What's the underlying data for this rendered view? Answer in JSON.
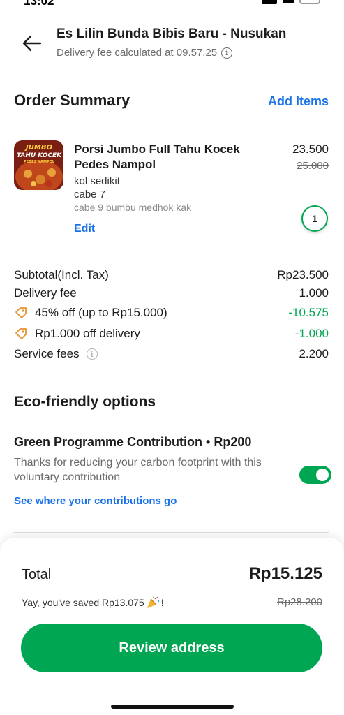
{
  "status_bar": {
    "time": "13:02"
  },
  "header": {
    "store_title": "Es Lilin Bunda Bibis Baru - Nusukan",
    "delivery_note": "Delivery fee calculated at 09.57.25"
  },
  "order_summary": {
    "title": "Order Summary",
    "add_items_label": "Add Items",
    "item": {
      "name": "Porsi Jumbo Full Tahu Kocek Pedes Nampol",
      "price": "23.500",
      "original_price": "25.000",
      "notes": [
        "kol sedikit",
        "cabe 7"
      ],
      "note_faded": "cabe 9 bumbu medhok kak",
      "edit_label": "Edit",
      "quantity": "1",
      "thumb_text_top": "JUMBO",
      "thumb_text_mid": "TAHU KOCEK",
      "thumb_text_bot": "PEDES NAMPOL"
    }
  },
  "breakdown": {
    "subtotal_label": "Subtotal(Incl. Tax)",
    "subtotal_value": "Rp23.500",
    "delivery_label": "Delivery fee",
    "delivery_value": "1.000",
    "promo1_label": "45% off (up to Rp15.000)",
    "promo1_value": "-10.575",
    "promo2_label": "Rp1.000 off delivery",
    "promo2_value": "-1.000",
    "service_label": "Service fees",
    "service_value": "2.200"
  },
  "eco": {
    "title": "Eco-friendly options",
    "programme_title": "Green Programme Contribution • Rp200",
    "programme_desc": "Thanks for reducing your carbon footprint with this voluntary contribution",
    "link_label": "See where your contributions go",
    "toggle_on": true
  },
  "footer": {
    "total_label": "Total",
    "total_value": "Rp15.125",
    "saved_text": "Yay, you've saved Rp13.075",
    "saved_suffix": "!",
    "original_total": "Rp28.200",
    "cta_label": "Review address"
  },
  "colors": {
    "accent_green": "#00a651",
    "link_blue": "#1a73e8",
    "promo_orange": "#e8912d"
  }
}
